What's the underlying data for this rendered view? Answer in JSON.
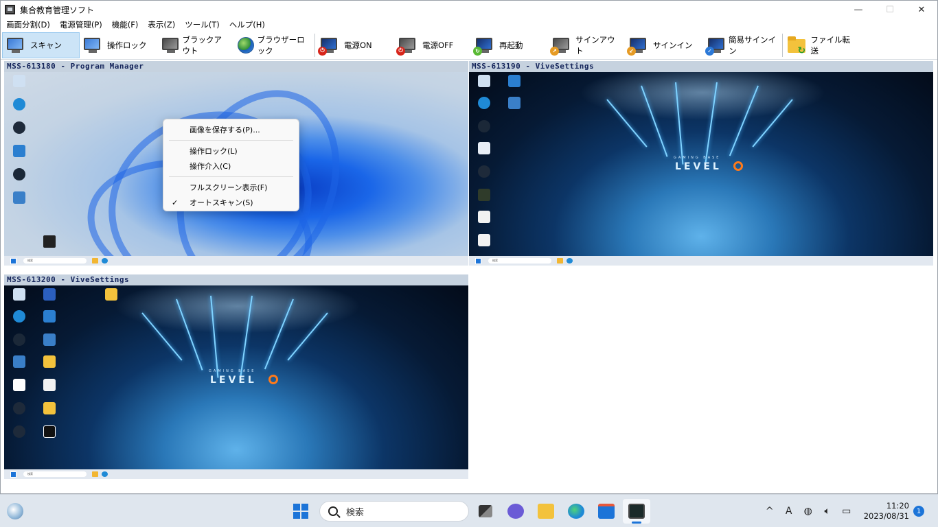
{
  "window": {
    "title": "集合教育管理ソフト",
    "minimize": "—",
    "maximize": "☐",
    "close": "✕"
  },
  "menu": [
    {
      "label": "画面分割(D)"
    },
    {
      "label": "電源管理(P)"
    },
    {
      "label": "機能(F)"
    },
    {
      "label": "表示(Z)"
    },
    {
      "label": "ツール(T)"
    },
    {
      "label": "ヘルプ(H)"
    }
  ],
  "toolbar": [
    {
      "label": "スキャン",
      "icon": "monitor-scan-icon"
    },
    {
      "label": "操作ロック",
      "icon": "computer-lock-icon"
    },
    {
      "label": "ブラックアウト",
      "icon": "monitor-blackout-icon"
    },
    {
      "label": "ブラウザーロック",
      "icon": "globe-icon"
    },
    {
      "label": "電源ON",
      "icon": "power-on-icon"
    },
    {
      "label": "電源OFF",
      "icon": "power-off-icon"
    },
    {
      "label": "再起動",
      "icon": "restart-icon"
    },
    {
      "label": "サインアウト",
      "icon": "sign-out-icon"
    },
    {
      "label": "サインイン",
      "icon": "sign-in-icon"
    },
    {
      "label": "簡易サインイン",
      "icon": "quick-sign-in-icon"
    },
    {
      "label": "ファイル転送",
      "icon": "file-transfer-icon"
    }
  ],
  "panes": [
    {
      "title": "MSS-613180  -  Program Manager"
    },
    {
      "title": "MSS-613190  -  ViveSettings"
    },
    {
      "title": "MSS-613200  -  ViveSettings"
    }
  ],
  "mini": {
    "search": "検索",
    "logo_sub": "GAMING BASE",
    "logo": "LEVEL"
  },
  "context_menu": {
    "save_image": "画像を保存する(P)...",
    "operation_lock": "操作ロック(L)",
    "operation_intervene": "操作介入(C)",
    "fullscreen": "フルスクリーン表示(F)",
    "auto_scan": "オートスキャン(S)",
    "check": "✓"
  },
  "taskbar": {
    "search_placeholder": "検索",
    "time": "11:20",
    "date": "2023/08/31",
    "notifications": "1",
    "tray_chevron": "^",
    "ime": "A"
  },
  "colors": {
    "accent": "#1c74d8",
    "pane_title_bg": "#c6d2df",
    "toolbar_active": "#cce4f7"
  }
}
